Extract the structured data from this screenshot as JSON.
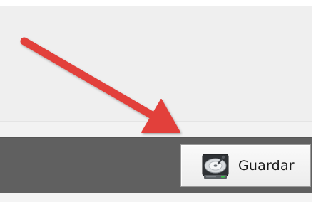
{
  "footer": {
    "save_button": {
      "label": "Guardar",
      "icon": "hard-drive-icon"
    }
  },
  "annotation": {
    "arrow_color": "#e2403a",
    "points_to": "save-button"
  },
  "colors": {
    "footer_background": "#606060",
    "panel_background": "#efefef",
    "button_background": "#f2f2f2"
  }
}
